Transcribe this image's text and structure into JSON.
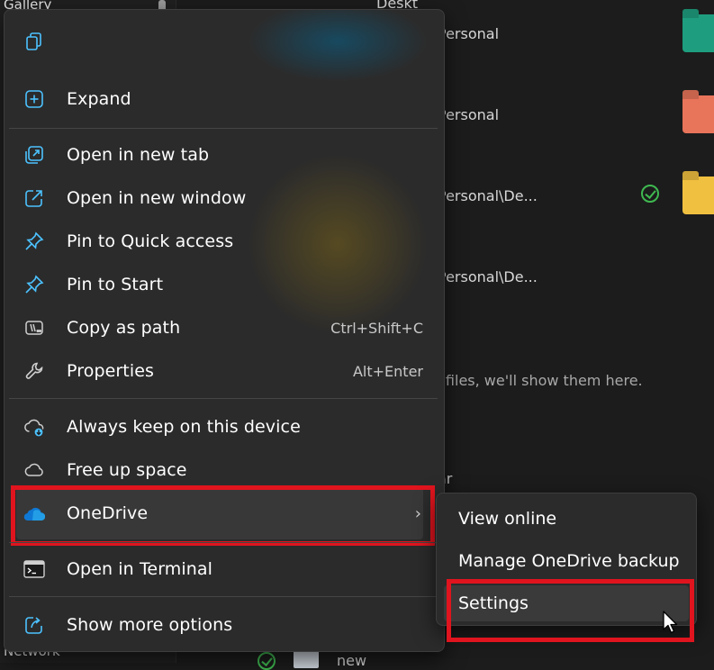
{
  "background": {
    "nav_top": "Gallery",
    "nav_bottom": "Network",
    "partial_top": "Deskt",
    "paths": [
      "Personal",
      "Personal",
      "Personal\\De...",
      "Personal\\De..."
    ],
    "empty_message": "e files, we'll show them here.",
    "partial_label": "ar",
    "partial_bottom": "new"
  },
  "menu": {
    "items": [
      {
        "id": "copy",
        "label": "",
        "shortcut": ""
      },
      {
        "id": "expand",
        "label": "Expand",
        "shortcut": ""
      },
      {
        "id": "open-new-tab",
        "label": "Open in new tab",
        "shortcut": ""
      },
      {
        "id": "open-new-window",
        "label": "Open in new window",
        "shortcut": ""
      },
      {
        "id": "pin-quick-access",
        "label": "Pin to Quick access",
        "shortcut": ""
      },
      {
        "id": "pin-start",
        "label": "Pin to Start",
        "shortcut": ""
      },
      {
        "id": "copy-path",
        "label": "Copy as path",
        "shortcut": "Ctrl+Shift+C"
      },
      {
        "id": "properties",
        "label": "Properties",
        "shortcut": "Alt+Enter"
      },
      {
        "id": "always-keep",
        "label": "Always keep on this device",
        "shortcut": ""
      },
      {
        "id": "free-up",
        "label": "Free up space",
        "shortcut": ""
      },
      {
        "id": "onedrive",
        "label": "OneDrive",
        "shortcut": ""
      },
      {
        "id": "terminal",
        "label": "Open in Terminal",
        "shortcut": ""
      },
      {
        "id": "more-options",
        "label": "Show more options",
        "shortcut": ""
      }
    ]
  },
  "submenu": {
    "items": [
      {
        "label": "View online"
      },
      {
        "label": "Manage OneDrive backup"
      },
      {
        "label": "Settings"
      }
    ]
  },
  "colors": {
    "highlight": "#e0141e",
    "accent": "#4cc2ff",
    "onedrive": "#0f78d4",
    "check": "#3fb950"
  }
}
